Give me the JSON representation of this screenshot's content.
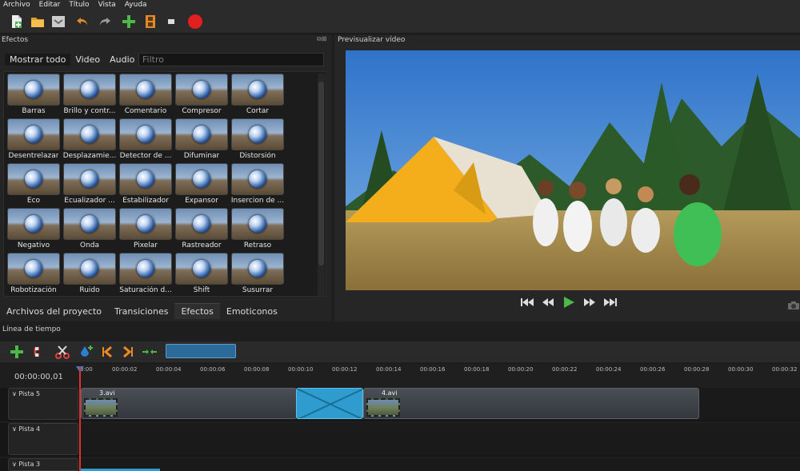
{
  "menu": [
    "Archivo",
    "Editar",
    "Título",
    "Vista",
    "Ayuda"
  ],
  "effects_panel": {
    "title": "Efectos",
    "tabs": [
      "Mostrar todo",
      "Video",
      "Audio"
    ],
    "filter_placeholder": "Filtro",
    "items": [
      "Barras",
      "Brillo y contr...",
      "Comentario",
      "Compresor",
      "Cortar",
      "Desentrelazar",
      "Desplazamie...",
      "Detector de ...",
      "Difuminar",
      "Distorsión",
      "Eco",
      "Ecualizador ...",
      "Estabilizador",
      "Expansor",
      "Insercion de ...",
      "Negativo",
      "Onda",
      "Pixelar",
      "Rastreador",
      "Retraso",
      "Robotización",
      "Ruido",
      "Saturación d...",
      "Shift",
      "Susurrar"
    ]
  },
  "bottom_tabs": [
    "Archivos del proyecto",
    "Transiciones",
    "Efectos",
    "Emoticonos"
  ],
  "preview": {
    "title": "Previsualizar vídeo"
  },
  "timeline": {
    "title": "Línea de tiempo",
    "timecode": "00:00:00,01",
    "ruler": [
      "0:00",
      "00:00:02",
      "00:00:04",
      "00:00:06",
      "00:00:08",
      "00:00:10",
      "00:00:12",
      "00:00:14",
      "00:00:16",
      "00:00:18",
      "00:00:20",
      "00:00:22",
      "00:00:24",
      "00:00:26",
      "00:00:28",
      "00:00:30",
      "00:00:32"
    ],
    "tracks": [
      "Pista 5",
      "Pista 4",
      "Pista 3"
    ],
    "clips": [
      "3.avi",
      "4.avi"
    ]
  },
  "colors": {
    "accent": "#2f9ccf",
    "playhead": "#e23030",
    "record": "#e02020"
  }
}
